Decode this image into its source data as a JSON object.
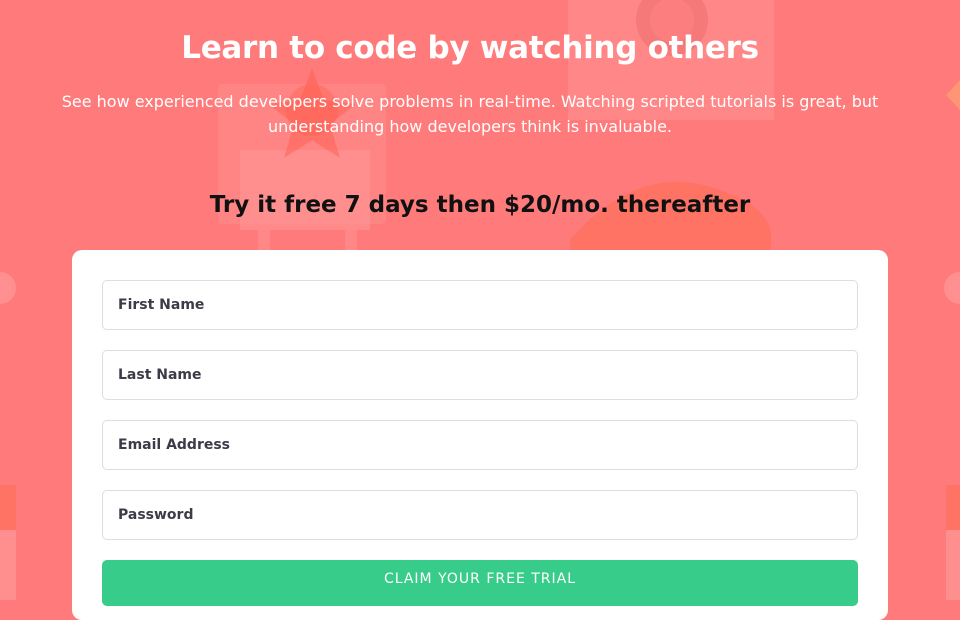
{
  "hero": {
    "title": "Learn to code by watching others",
    "subtitle": "See how experienced developers solve problems in real-time. Watching scripted tutorials is great, but understanding how developers think is invaluable."
  },
  "offer": {
    "text": "Try it free 7 days then $20/mo. thereafter"
  },
  "form": {
    "first_name_placeholder": "First Name",
    "last_name_placeholder": "Last Name",
    "email_placeholder": "Email Address",
    "password_placeholder": "Password",
    "submit_label": "CLAIM YOUR FREE TRIAL"
  },
  "colors": {
    "background": "#ff7a7a",
    "accent_green": "#38cc8b",
    "card": "#ffffff"
  }
}
